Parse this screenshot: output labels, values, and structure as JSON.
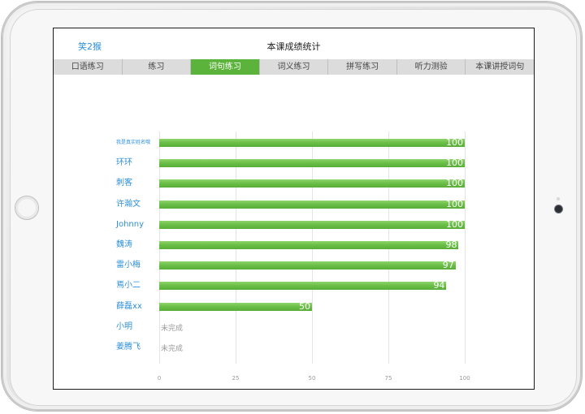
{
  "nav": {
    "back_label": "笑2猴",
    "title": "本课成绩统计"
  },
  "tabs": [
    {
      "label": "口语练习",
      "active": false
    },
    {
      "label": "练习",
      "active": false
    },
    {
      "label": "词句练习",
      "active": true
    },
    {
      "label": "词义练习",
      "active": false
    },
    {
      "label": "拼写练习",
      "active": false
    },
    {
      "label": "听力测验",
      "active": false
    },
    {
      "label": "本课讲授词句",
      "active": false
    }
  ],
  "colors": {
    "accent": "#5cb33b",
    "bar": "#6cc049",
    "name_text": "#2d8fd8",
    "pending_text": "#9a9a9a"
  },
  "chart_data": {
    "type": "bar",
    "orientation": "horizontal",
    "categories": [
      "我是真实姓名哦",
      "环环",
      "刺客",
      "许瀚文",
      "Johnny",
      "魏涛",
      "雷小梅",
      "焉小二",
      "薛磊xx",
      "小明",
      "姜腾飞"
    ],
    "values": [
      100,
      100,
      100,
      100,
      100,
      98,
      97,
      94,
      50,
      null,
      null
    ],
    "pending_label": "未完成",
    "xlim": [
      0,
      100
    ],
    "xticks": [
      "0",
      "25",
      "50",
      "75",
      "100"
    ],
    "grid": true,
    "legend": "none"
  }
}
